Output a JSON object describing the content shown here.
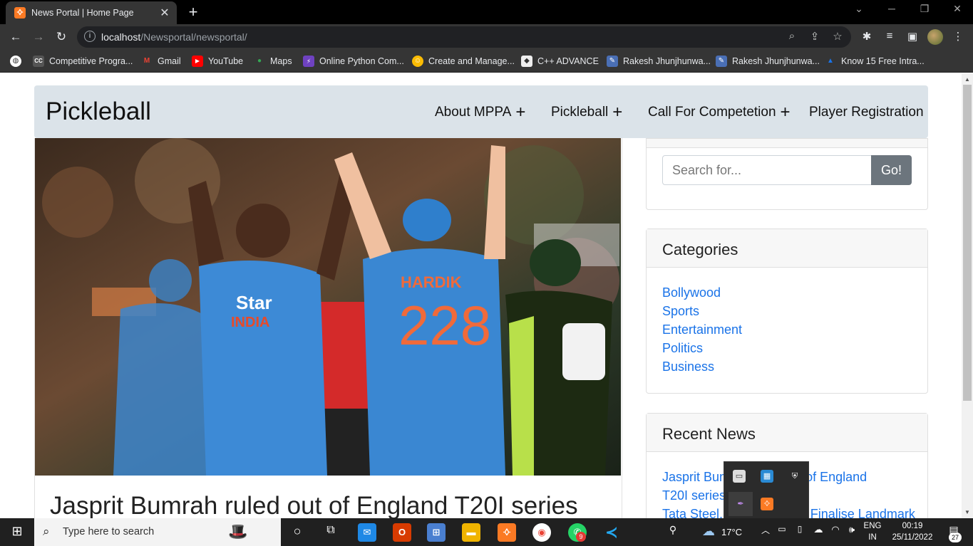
{
  "browser": {
    "tab_title": "News Portal | Home Page",
    "tab_icon_glyph": "ꕻ",
    "url_host": "localhost",
    "url_path": "/Newsportal/newsportal/",
    "bookmarks": [
      {
        "label": "Competitive Progra...",
        "icon": "cc-icon",
        "color": "#555555",
        "glyph": "CC"
      },
      {
        "label": "Gmail",
        "icon": "gmail-icon",
        "color": "#d93025",
        "glyph": "M"
      },
      {
        "label": "YouTube",
        "icon": "youtube-icon",
        "color": "#ff0000",
        "glyph": "▶"
      },
      {
        "label": "Maps",
        "icon": "maps-icon",
        "color": "#34a853",
        "glyph": "●"
      },
      {
        "label": "Online Python Com...",
        "icon": "bolt-icon",
        "color": "#6f42c1",
        "glyph": "⚡"
      },
      {
        "label": "Create and Manage...",
        "icon": "smile-icon",
        "color": "#fbbc04",
        "glyph": "☺"
      },
      {
        "label": "C++ ADVANCE",
        "icon": "cpp-icon",
        "color": "#444444",
        "glyph": "◆"
      },
      {
        "label": "Rakesh Jhunjhunwa...",
        "icon": "article-icon",
        "color": "#4a6fb5",
        "glyph": "✎"
      },
      {
        "label": "Rakesh Jhunjhunwa...",
        "icon": "article-icon",
        "color": "#4a6fb5",
        "glyph": "✎"
      },
      {
        "label": "Know 15 Free Intra...",
        "icon": "triangle-icon",
        "color": "#1a73e8",
        "glyph": "▲"
      }
    ]
  },
  "site": {
    "brand": "Pickleball",
    "nav": [
      {
        "label": "About MPPA",
        "has_plus": true
      },
      {
        "label": "Pickleball",
        "has_plus": true
      },
      {
        "label": "Call For Competetion",
        "has_plus": true
      },
      {
        "label": "Player Registration",
        "has_plus": false
      }
    ],
    "plus_glyph": "+",
    "post_title": "Jasprit Bumrah ruled out of England T20I series",
    "search": {
      "placeholder": "Search for...",
      "button": "Go!"
    },
    "categories_title": "Categories",
    "categories": [
      "Bollywood",
      "Sports",
      "Entertainment",
      "Politics",
      "Business"
    ],
    "recent_title": "Recent News",
    "recent_news": [
      "Jasprit Bumrah ruled out of England T20I series due to injury",
      "Tata Steel, Thyssenkrupp Finalise Landmark"
    ],
    "hero_jersey_name": "HARDIK",
    "hero_jersey_number": "228",
    "hero_sponsor": "Star",
    "hero_country": "INDIA"
  },
  "taskbar": {
    "search_placeholder": "Type here to search",
    "temperature": "17°C",
    "lang_line1": "ENG",
    "lang_line2": "IN",
    "time": "00:19",
    "date": "25/11/2022",
    "notifications": "27",
    "whatsapp_badge": "9"
  }
}
